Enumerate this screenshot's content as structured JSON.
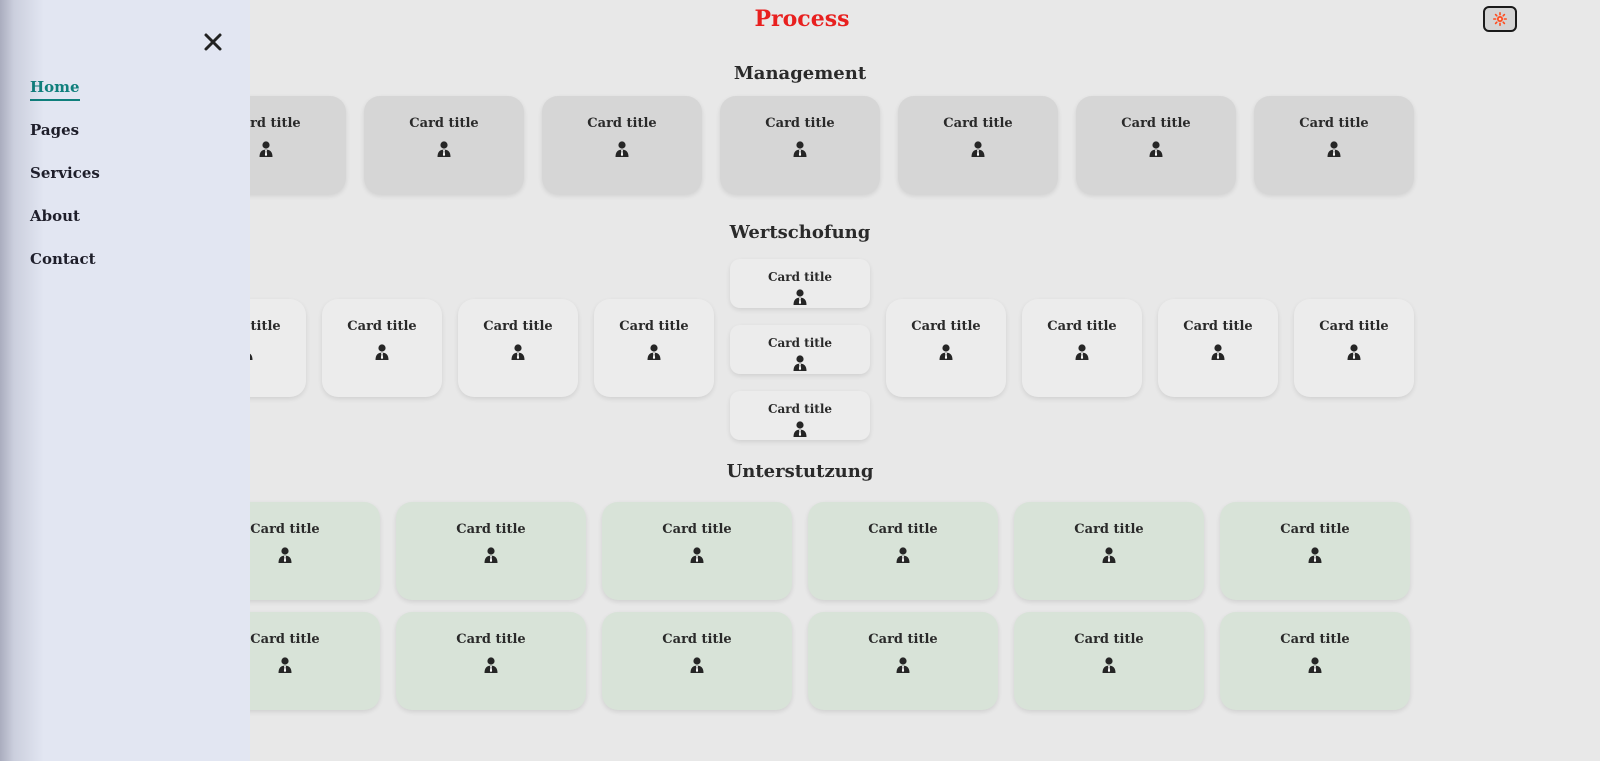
{
  "header": {
    "title": "Process",
    "theme_icon": "sun-icon",
    "theme_icon_color": "#ff4a1c",
    "title_color": "#e8201f"
  },
  "drawer": {
    "close_icon": "close-icon",
    "items": [
      {
        "label": "Home",
        "active": true
      },
      {
        "label": "Pages",
        "active": false
      },
      {
        "label": "Services",
        "active": false
      },
      {
        "label": "About",
        "active": false
      },
      {
        "label": "Contact",
        "active": false
      }
    ],
    "active_color": "#0f7f7c"
  },
  "sections": {
    "management": {
      "title": "Management",
      "card_icon": "person-icon",
      "cards": [
        "Card title",
        "Card title",
        "Card title",
        "Card title",
        "Card title",
        "Card title",
        "Card title",
        "Card title"
      ]
    },
    "wertschofung": {
      "title": "Wertschofung",
      "card_icon": "person-icon",
      "left_cards": [
        "Card title",
        "Card title",
        "Card title",
        "Card title"
      ],
      "center_cards": [
        "Card title",
        "Card title",
        "Card title"
      ],
      "right_cards": [
        "Card title",
        "Card title",
        "Card title",
        "Card title"
      ]
    },
    "unterstutzung": {
      "title": "Unterstutzung",
      "card_icon": "person-icon",
      "rows": [
        [
          "Card title",
          "Card title",
          "Card title",
          "Card title",
          "Card title",
          "Card title"
        ],
        [
          "Card title",
          "Card title",
          "Card title",
          "Card title",
          "Card title",
          "Card title"
        ]
      ]
    }
  }
}
